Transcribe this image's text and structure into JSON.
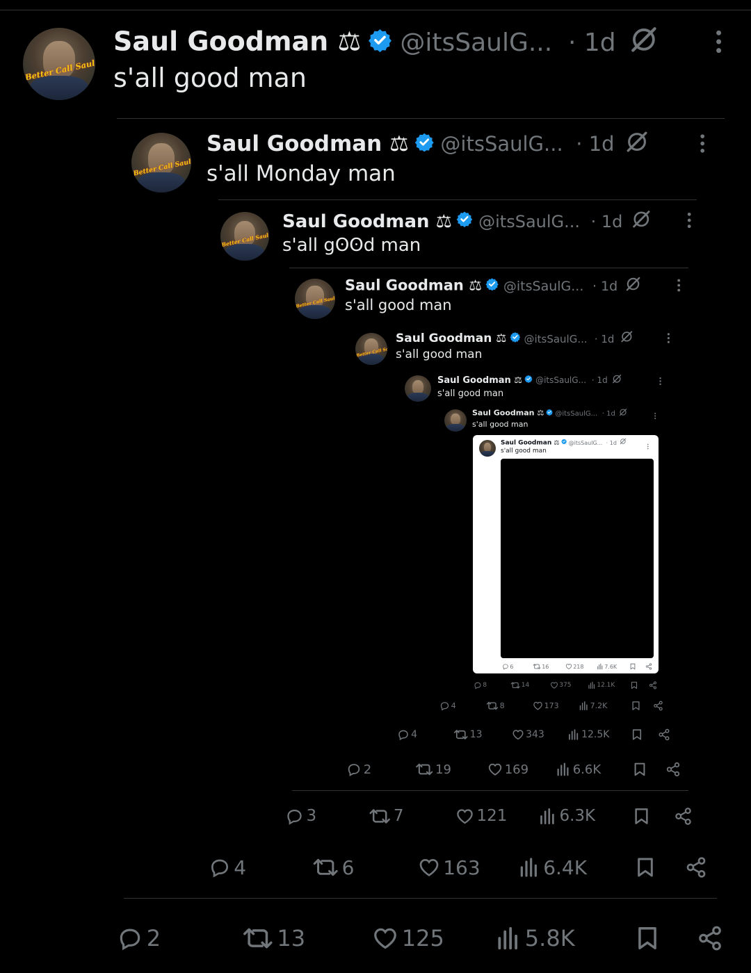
{
  "levels": [
    {
      "name": "Saul Goodman ⚖",
      "handle": "@itsSaulG...",
      "time": "· 1d",
      "text": "s'all good man",
      "stats": {
        "replies": "2",
        "reposts": "13",
        "likes": "125",
        "views": "5.8K"
      }
    },
    {
      "name": "Saul Goodman ⚖",
      "handle": "@itsSaulG...",
      "time": "· 1d",
      "text": "s'all Monday man",
      "stats": {
        "replies": "4",
        "reposts": "6",
        "likes": "163",
        "views": "6.4K"
      }
    },
    {
      "name": "Saul Goodman ⚖",
      "handle": "@itsSaulG...",
      "time": "· 1d",
      "text": "s'all gʘʘd man",
      "stats": {
        "replies": "3",
        "reposts": "7",
        "likes": "121",
        "views": "6.3K"
      }
    },
    {
      "name": "Saul Goodman ⚖",
      "handle": "@itsSaulG...",
      "time": "· 1d",
      "text": "s'all good man",
      "stats": {
        "replies": "2",
        "reposts": "19",
        "likes": "169",
        "views": "6.6K"
      }
    },
    {
      "name": "Saul Goodman ⚖",
      "handle": "@itsSaulG...",
      "time": "· 1d",
      "text": "s'all good man",
      "stats": {
        "replies": "4",
        "reposts": "13",
        "likes": "343",
        "views": "12.5K"
      }
    },
    {
      "name": "Saul Goodman ⚖",
      "handle": "@itsSaulG...",
      "time": "· 1d",
      "text": "s'all good man",
      "stats": {
        "replies": "4",
        "reposts": "8",
        "likes": "173",
        "views": "7.2K"
      }
    },
    {
      "name": "Saul Goodman ⚖",
      "handle": "@itsSaulG...",
      "time": "· 1d",
      "text": "s'all good man",
      "stats": {
        "replies": "8",
        "reposts": "14",
        "likes": "375",
        "views": "12.1K"
      }
    },
    {
      "name": "Saul Goodman ⚖",
      "handle": "@itsSaulG...",
      "time": "· 1d",
      "text": "s'all good man",
      "stats": {
        "replies": "6",
        "reposts": "16",
        "likes": "218",
        "views": "7.6K"
      }
    }
  ],
  "avatar_logo": "Better Call Saul",
  "colors": {
    "verified": "#1d9bf0",
    "muted": "#71767b",
    "text": "#e7e9ea",
    "bg": "#000000",
    "separator": "#2f3336"
  }
}
